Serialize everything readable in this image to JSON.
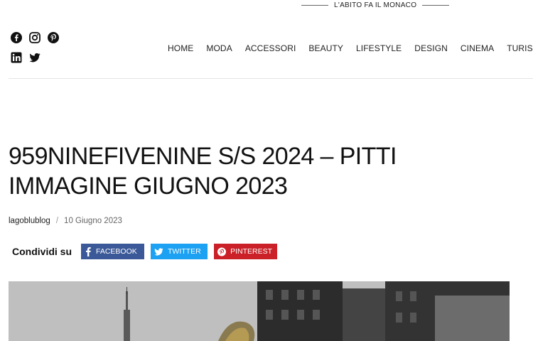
{
  "header": {
    "tagline": "L'ABITO FA IL MONACO"
  },
  "social": {
    "icons": [
      "facebook-icon",
      "instagram-icon",
      "pinterest-icon",
      "linkedin-icon",
      "twitter-icon"
    ]
  },
  "nav": {
    "items": [
      "HOME",
      "MODA",
      "ACCESSORI",
      "BEAUTY",
      "LIFESTYLE",
      "DESIGN",
      "CINEMA",
      "TURISMO"
    ]
  },
  "article": {
    "title": "959NINEFIVENINE S/S 2024 – PITTI IMMAGINE GIUGNO 2023",
    "author": "lagoblublog",
    "separator": "/",
    "date": "10 Giugno 2023"
  },
  "share": {
    "label": "Condividi su",
    "facebook": "FACEBOOK",
    "twitter": "TWITTER",
    "pinterest": "PINTEREST"
  },
  "colors": {
    "facebook": "#3b5998",
    "twitter": "#1da1f2",
    "pinterest": "#cb2027"
  }
}
